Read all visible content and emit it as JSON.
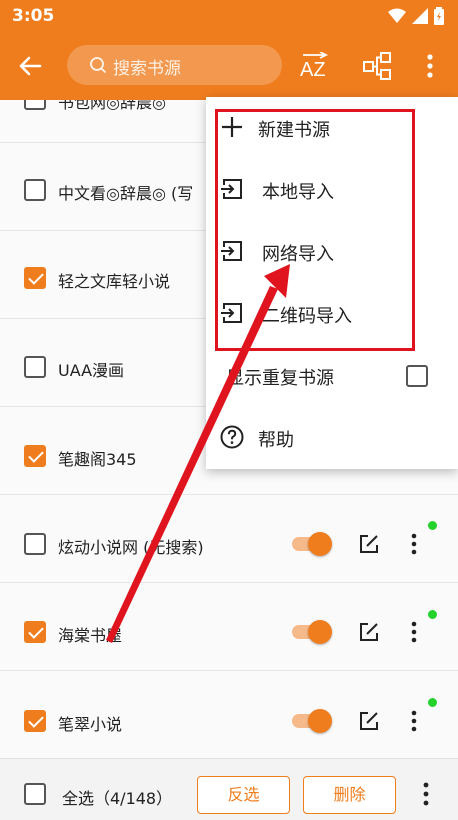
{
  "status_bar": {
    "time": "3:05"
  },
  "toolbar": {
    "search_placeholder": "搜索书源",
    "sort_label": "AZ"
  },
  "sources": [
    {
      "name": "书包网◎辞晨◎",
      "checked": false
    },
    {
      "name": "中文看◎辞晨◎ (写",
      "checked": false
    },
    {
      "name": "轻之文库轻小说",
      "checked": true
    },
    {
      "name": "UAA漫画",
      "checked": false
    },
    {
      "name": "笔趣阁345",
      "checked": true
    },
    {
      "name": "炫动小说网 (无搜索)",
      "checked": false
    },
    {
      "name": "海棠书屋",
      "checked": true
    },
    {
      "name": "笔翠小说",
      "checked": true
    }
  ],
  "menu": {
    "new_source": "新建书源",
    "local_import": "本地导入",
    "network_import": "网络导入",
    "qr_import": "二维码导入",
    "show_duplicates": "显示重复书源",
    "help": "帮助"
  },
  "bottom_bar": {
    "select_all": "全选（4/148）",
    "invert": "反选",
    "delete": "删除"
  },
  "colors": {
    "accent": "#ef7d1e",
    "annotation_red": "#e0141e",
    "online_dot": "#23d22a"
  }
}
